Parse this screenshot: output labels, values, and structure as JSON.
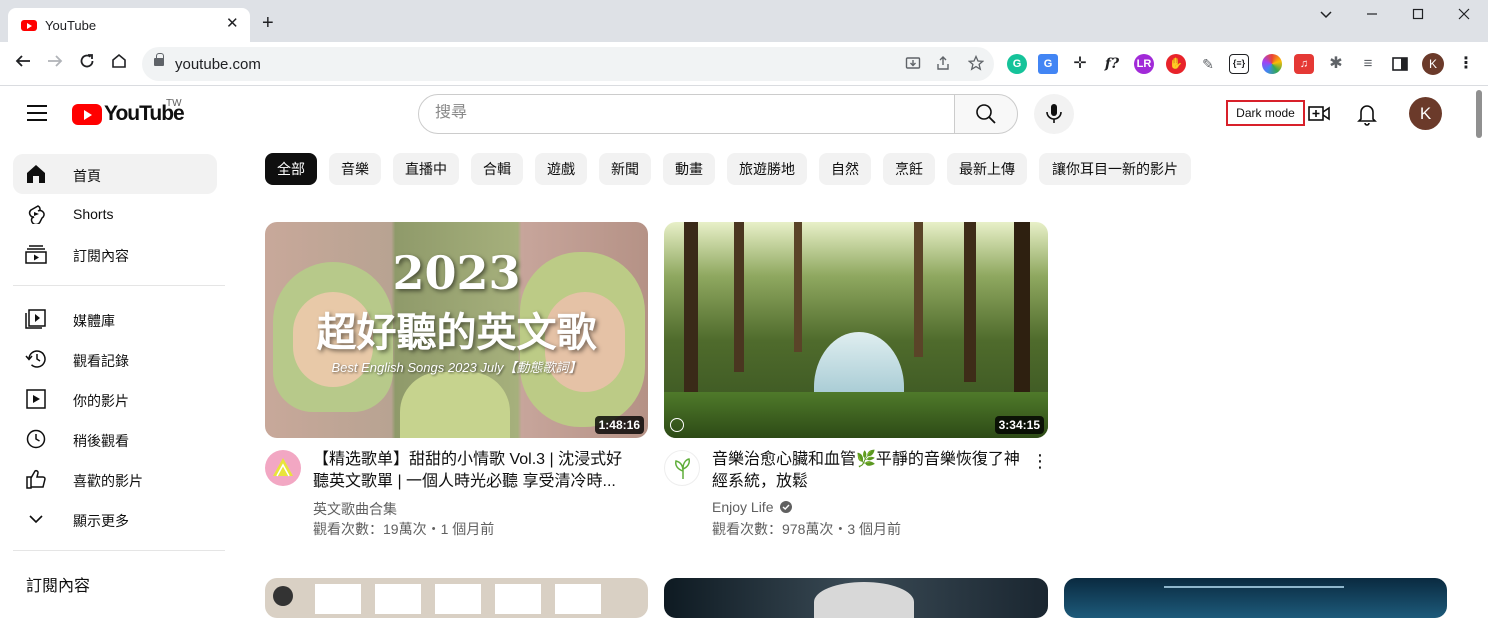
{
  "browser": {
    "tab_title": "YouTube",
    "tab_close": "✕",
    "new_tab": "+",
    "url": "youtube.com",
    "profile_initial": "K"
  },
  "masthead": {
    "logo_text": "YouTube",
    "region": "TW",
    "search_placeholder": "搜尋",
    "dark_mode_label": "Dark mode",
    "avatar_initial": "K"
  },
  "sidebar": {
    "items": [
      {
        "label": "首頁",
        "icon": "home-icon",
        "active": true
      },
      {
        "label": "Shorts",
        "icon": "shorts-icon"
      },
      {
        "label": "訂閱內容",
        "icon": "subscriptions-icon"
      },
      {
        "label": "媒體庫",
        "icon": "library-icon"
      },
      {
        "label": "觀看記錄",
        "icon": "history-icon"
      },
      {
        "label": "你的影片",
        "icon": "your-videos-icon"
      },
      {
        "label": "稍後觀看",
        "icon": "watch-later-icon"
      },
      {
        "label": "喜歡的影片",
        "icon": "liked-videos-icon"
      },
      {
        "label": "顯示更多",
        "icon": "chevron-down-icon"
      }
    ],
    "subscriptions_heading": "訂閱內容"
  },
  "chips": [
    "全部",
    "音樂",
    "直播中",
    "合輯",
    "遊戲",
    "新聞",
    "動畫",
    "旅遊勝地",
    "自然",
    "烹飪",
    "最新上傳",
    "讓你耳目一新的影片"
  ],
  "videos": [
    {
      "thumb_title": "2023",
      "thumb_subtitle": "超好聽的英文歌",
      "thumb_caption": "Best English Songs 2023 July【動態歌詞】",
      "duration": "1:48:16",
      "title": "【精选歌单】甜甜的小情歌 Vol.3 | 沈浸式好聽英文歌單 | 一個人時光必聽 享受清冷時...",
      "channel": "英文歌曲合集",
      "meta": "觀看次數：19萬次・1 個月前"
    },
    {
      "duration": "3:34:15",
      "title": "音樂治愈心臟和血管🌿平靜的音樂恢復了神經系統，放鬆",
      "channel": "Enjoy Life",
      "meta": "觀看次數：978萬次・3 個月前"
    }
  ],
  "colors": {
    "accent_red": "#ff0000",
    "active_chip": "#0f0f0f",
    "chip_bg": "#f2f2f2",
    "highlight_border": "#d8202a"
  }
}
